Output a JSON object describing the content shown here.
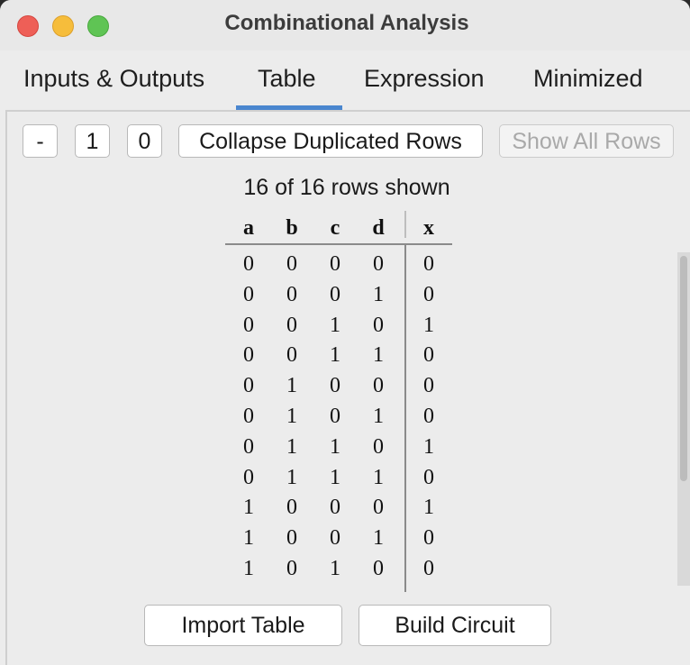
{
  "window": {
    "title": "Combinational Analysis"
  },
  "tabs": [
    {
      "label": "Inputs & Outputs",
      "selected": false
    },
    {
      "label": "Table",
      "selected": true
    },
    {
      "label": "Expression",
      "selected": false
    },
    {
      "label": "Minimized",
      "selected": false
    }
  ],
  "toolbar": {
    "dash_label": "-",
    "one_label": "1",
    "zero_label": "0",
    "collapse_label": "Collapse Duplicated Rows",
    "show_all_label": "Show All Rows"
  },
  "table": {
    "status": "16 of 16 rows shown",
    "inputs": [
      "a",
      "b",
      "c",
      "d"
    ],
    "outputs": [
      "x"
    ],
    "rows": [
      [
        "0",
        "0",
        "0",
        "0",
        "0"
      ],
      [
        "0",
        "0",
        "0",
        "1",
        "0"
      ],
      [
        "0",
        "0",
        "1",
        "0",
        "1"
      ],
      [
        "0",
        "0",
        "1",
        "1",
        "0"
      ],
      [
        "0",
        "1",
        "0",
        "0",
        "0"
      ],
      [
        "0",
        "1",
        "0",
        "1",
        "0"
      ],
      [
        "0",
        "1",
        "1",
        "0",
        "1"
      ],
      [
        "0",
        "1",
        "1",
        "1",
        "0"
      ],
      [
        "1",
        "0",
        "0",
        "0",
        "1"
      ],
      [
        "1",
        "0",
        "0",
        "1",
        "0"
      ],
      [
        "1",
        "0",
        "1",
        "0",
        "0"
      ]
    ]
  },
  "footer": {
    "import_label": "Import Table",
    "build_label": "Build Circuit"
  },
  "colors": {
    "tab_underline": "#4a86cf",
    "close": "#ee5f57",
    "minimize": "#f6bd3b",
    "zoom": "#5fc454"
  }
}
